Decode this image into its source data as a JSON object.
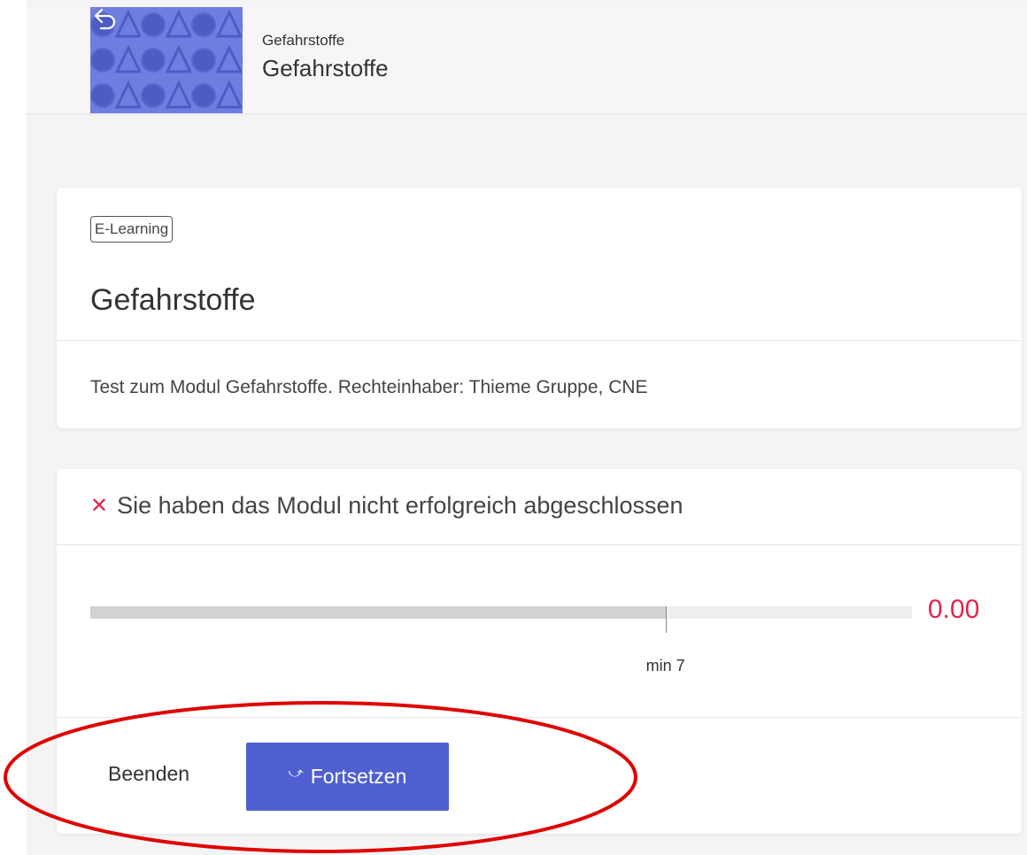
{
  "header": {
    "subtitle": "Gefahrstoffe",
    "title": "Gefahrstoffe",
    "thumbnail_color": "#6e7ee0"
  },
  "course": {
    "badge": "E-Learning",
    "title": "Gefahrstoffe",
    "description": "Test zum Modul Gefahrstoffe. Rechteinhaber: Thieme Gruppe, CNE"
  },
  "result": {
    "status_text": "Sie haben das Modul nicht erfolgreich abgeschlossen",
    "status_icon": "x-icon",
    "status_color": "#e0254f",
    "score": "0.00",
    "min_label": "min 7",
    "progress_fraction": 0.7,
    "min_fraction": 0.7
  },
  "actions": {
    "end_label": "Beenden",
    "continue_label": "Fortsetzen",
    "continue_icon": "resume-icon",
    "primary_color": "#4f5fd0"
  },
  "annotation": {
    "color": "#e00000"
  }
}
